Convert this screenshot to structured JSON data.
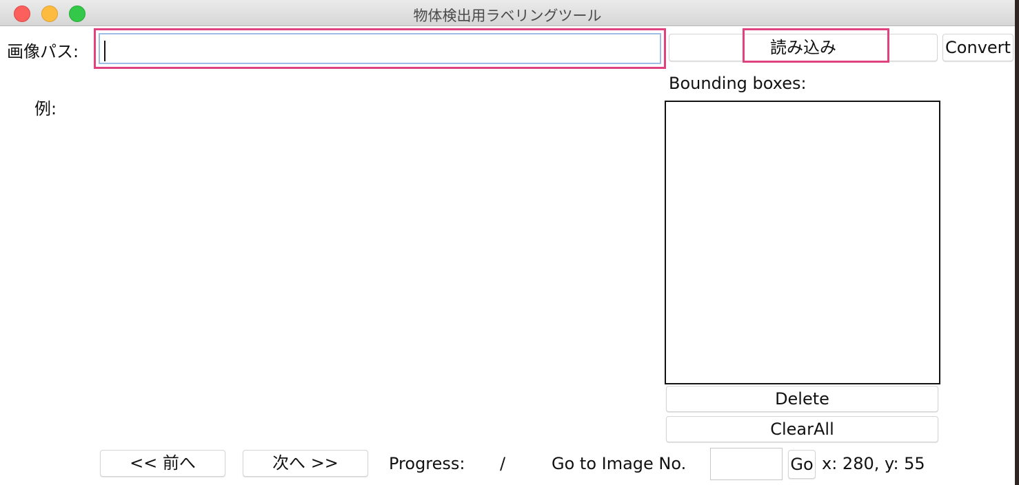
{
  "window": {
    "title": "物体検出用ラベリングツール"
  },
  "path": {
    "label": "画像パス:",
    "value": ""
  },
  "buttons": {
    "load": "読み込み",
    "convert": "Convert",
    "delete": "Delete",
    "clear_all": "ClearAll",
    "prev": "<< 前へ",
    "next": "次へ >>",
    "go": "Go"
  },
  "example_label": "例:",
  "bbox": {
    "label": "Bounding boxes:",
    "items": []
  },
  "status": {
    "progress_label": "Progress:",
    "progress_value": "/",
    "goto_label": "Go to Image No.",
    "goto_value": "",
    "coords": "x: 280, y: 55"
  },
  "colors": {
    "highlight": "#e0417f",
    "focus_ring": "#9dbde6"
  }
}
